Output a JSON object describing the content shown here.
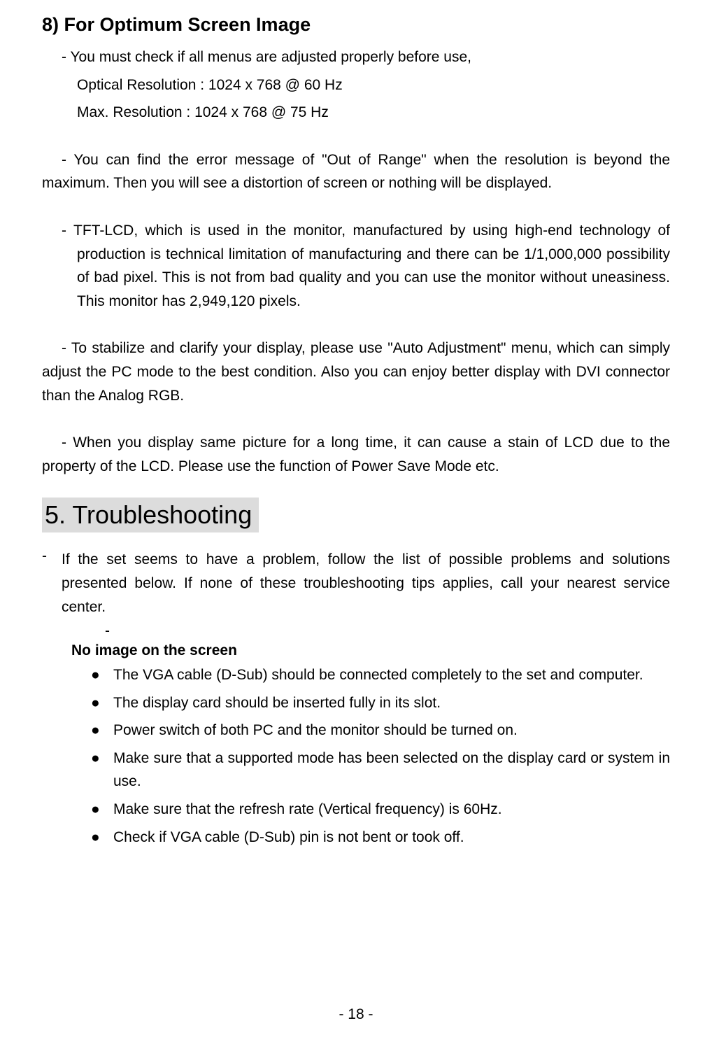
{
  "section8": {
    "title": "8) For Optimum Screen Image",
    "line1": "- You must check if all menus are adjusted properly before use,",
    "line2": "Optical Resolution : 1024 x 768 @ 60 Hz",
    "line3": "Max. Resolution : 1024 x 768 @ 75 Hz",
    "para1": "- You can find the error message of \"Out of Range\" when the resolution is beyond the maximum. Then you will see a distortion of screen or nothing will be displayed.",
    "para2": "- TFT-LCD, which is used in the monitor, manufactured by using high-end technology of production is technical limitation of manufacturing and there can be 1/1,000,000 possibility of bad pixel. This is not from bad quality and you can use the monitor without uneasiness. This monitor has 2,949,120 pixels.",
    "para3": "- To stabilize and clarify your display, please use \"Auto Adjustment\" menu, which can simply adjust the PC mode to the best condition. Also you can enjoy better display with DVI connector than the Analog RGB.",
    "para4": "- When you display same picture for a long time, it can cause a stain of LCD due to the property of the LCD. Please use the function of Power Save Mode etc."
  },
  "chapter5": {
    "title": "5. Troubleshooting",
    "intro_dash": "-",
    "intro": "If the set seems to have a problem, follow the list of possible problems and solutions presented below. If none of these troubleshooting tips applies, call your nearest service center.",
    "lone_dash": "-",
    "subheading": "No image on the screen",
    "bullets": [
      "The VGA cable (D-Sub) should be connected completely to the set and computer.",
      "The display card should be inserted fully in its slot.",
      "Power switch of both PC and the monitor should be turned on.",
      "Make sure that a supported mode has been selected on the display card or system in use.",
      "Make sure that the refresh rate (Vertical frequency) is 60Hz.",
      "Check if VGA cable (D-Sub) pin is not bent or took off."
    ]
  },
  "page_number": "- 18 -"
}
